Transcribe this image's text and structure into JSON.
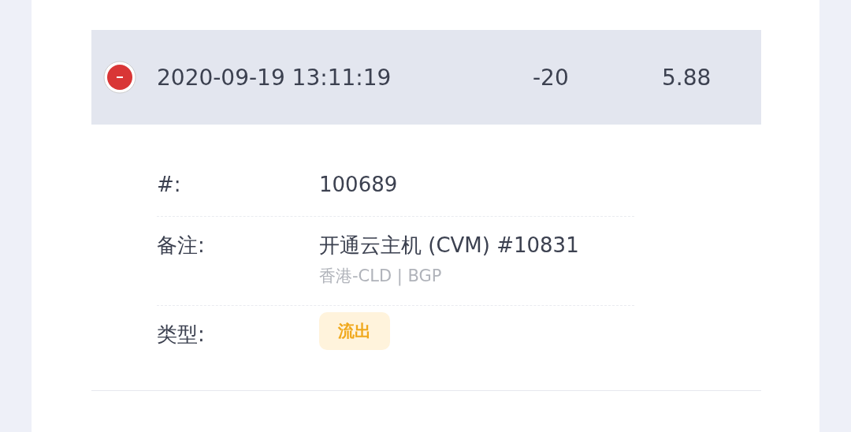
{
  "record": {
    "kind": "outflow",
    "expanded": true,
    "time": "2020-09-19 13:11:19",
    "amount": "-20",
    "balance": "5.88"
  },
  "details": [
    {
      "label": "#:",
      "value": "100689"
    },
    {
      "label": "备注:",
      "value": "开通云主机 (CVM) #10831",
      "sub": "香港-CLD | BGP"
    },
    {
      "label": "类型:",
      "tag": "流出"
    }
  ]
}
